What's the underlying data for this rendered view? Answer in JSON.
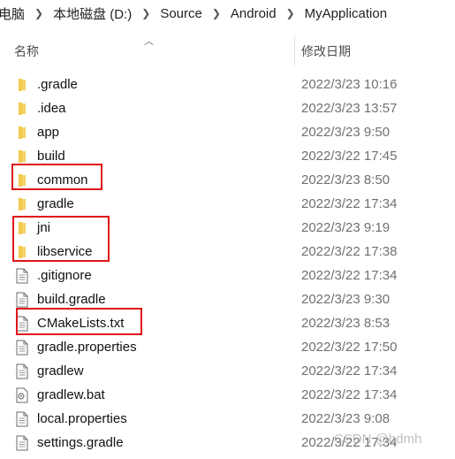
{
  "breadcrumb": [
    "电脑",
    "本地磁盘 (D:)",
    "Source",
    "Android",
    "MyApplication"
  ],
  "header": {
    "name_label": "名称",
    "date_label": "修改日期"
  },
  "files": [
    {
      "name": ".gradle",
      "date": "2022/3/23 10:16",
      "icon": "folder-icon"
    },
    {
      "name": ".idea",
      "date": "2022/3/23 13:57",
      "icon": "folder-icon"
    },
    {
      "name": "app",
      "date": "2022/3/23 9:50",
      "icon": "folder-icon"
    },
    {
      "name": "build",
      "date": "2022/3/22 17:45",
      "icon": "folder-icon"
    },
    {
      "name": "common",
      "date": "2022/3/23 8:50",
      "icon": "folder-icon"
    },
    {
      "name": "gradle",
      "date": "2022/3/22 17:34",
      "icon": "folder-icon"
    },
    {
      "name": "jni",
      "date": "2022/3/23 9:19",
      "icon": "folder-icon"
    },
    {
      "name": "libservice",
      "date": "2022/3/22 17:38",
      "icon": "folder-icon"
    },
    {
      "name": ".gitignore",
      "date": "2022/3/22 17:34",
      "icon": "file-icon"
    },
    {
      "name": "build.gradle",
      "date": "2022/3/23 9:30",
      "icon": "file-icon"
    },
    {
      "name": "CMakeLists.txt",
      "date": "2022/3/23 8:53",
      "icon": "file-icon"
    },
    {
      "name": "gradle.properties",
      "date": "2022/3/22 17:50",
      "icon": "file-icon"
    },
    {
      "name": "gradlew",
      "date": "2022/3/22 17:34",
      "icon": "file-icon"
    },
    {
      "name": "gradlew.bat",
      "date": "2022/3/22 17:34",
      "icon": "batch-file-icon"
    },
    {
      "name": "local.properties",
      "date": "2022/3/23 9:08",
      "icon": "file-icon"
    },
    {
      "name": "settings.gradle",
      "date": "2022/3/22 17:34",
      "icon": "file-icon"
    }
  ],
  "watermark": "CSDN @bdmh",
  "colors": {
    "folder": "#f2c94c",
    "highlight": "#e0141a"
  }
}
